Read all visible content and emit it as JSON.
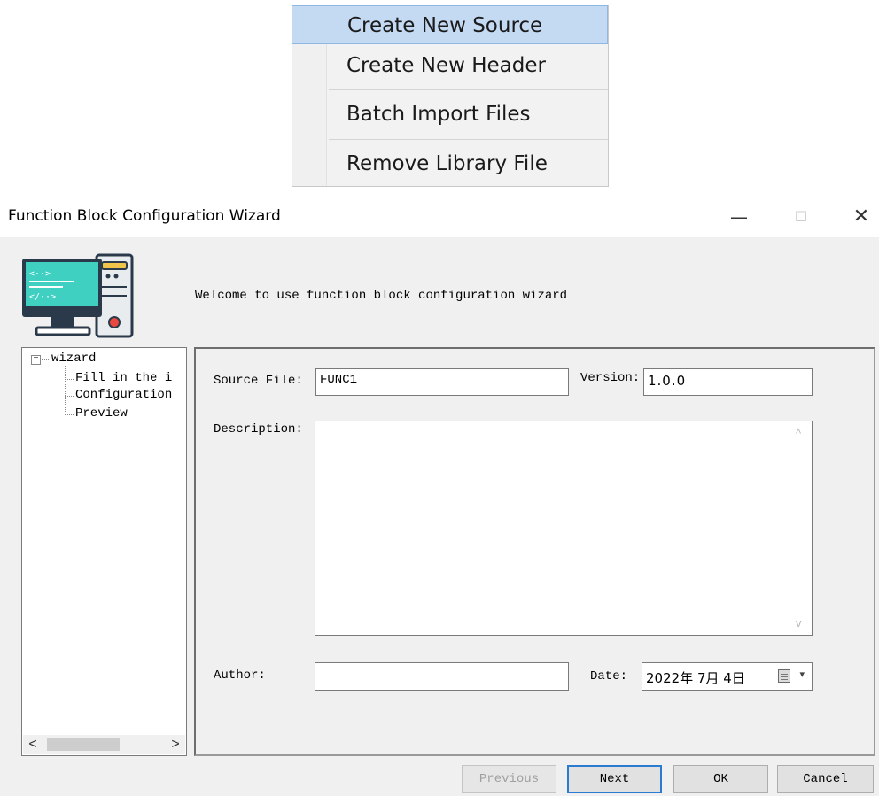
{
  "context_menu": {
    "items": [
      {
        "label": "Create New Source",
        "highlighted": true
      },
      {
        "label": "Create New Header",
        "highlighted": false
      },
      {
        "label": "Batch Import Files",
        "highlighted": false
      },
      {
        "label": "Remove Library File",
        "highlighted": false
      }
    ]
  },
  "window": {
    "title": "Function Block Configuration Wizard",
    "minimize_glyph": "—",
    "maximize_glyph": "☐",
    "close_glyph": "✕"
  },
  "header": {
    "icon": "computer-tower-icon",
    "welcome_text": "Welcome to use function block configuration wizard"
  },
  "tree": {
    "expander_glyph": "−",
    "root": "wizard",
    "children": [
      "Fill in the i",
      "Configuration",
      "Preview"
    ],
    "scroll_left": "<",
    "scroll_right": ">"
  },
  "form": {
    "source_file_label": "Source File:",
    "source_file_value": "FUNC1",
    "version_label": "Version:",
    "version_value": "1.0.0",
    "description_label": "Description:",
    "description_value": "",
    "scroll_up": "^",
    "scroll_down": "v",
    "author_label": "Author:",
    "author_value": "",
    "date_label": "Date:",
    "date_value": "2022年 7月 4日",
    "date_dropdown": "▾"
  },
  "buttons": {
    "previous": "Previous",
    "next": "Next",
    "ok": "OK",
    "cancel": "Cancel"
  },
  "colors": {
    "menu_highlight": "#c4d9f2",
    "default_button_border": "#2b7bd1",
    "dialog_bg": "#f0f0f0"
  }
}
